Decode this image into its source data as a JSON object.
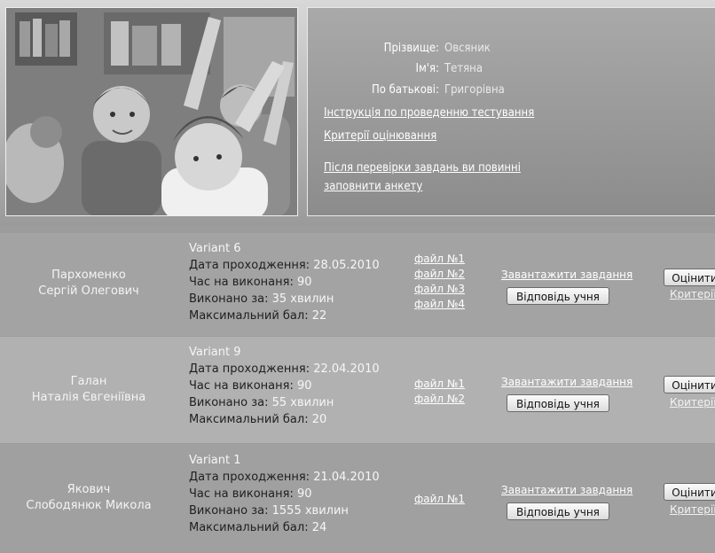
{
  "profile": {
    "surname_label": "Прізвище:",
    "surname": "Овсяник",
    "name_label": "Ім'я:",
    "name": "Тетяна",
    "patronymic_label": "По батькові:",
    "patronymic": "Григорівна",
    "instructions_link": "Інструкція по проведенню тестування",
    "criteria_link": "Критерії оцінювання",
    "survey_line1": "Після перевірки завдань ви повинні",
    "survey_line2": "заповнити анкету"
  },
  "labels": {
    "date": "Дата проходження:",
    "time": "Час на виконаня:",
    "done": "Виконано за:",
    "max": "Максимальний бал:",
    "download": "Завантажити завдання",
    "answer": "Відповідь учня",
    "grade": "Оцінити",
    "criteria": "Критерії"
  },
  "rows": [
    {
      "surname": "Пархоменко",
      "name": "Сергій Олегович",
      "variant": "Variant 6",
      "date": "28.05.2010",
      "time": "90",
      "done": "35 хвилин",
      "max": "22",
      "files": [
        "файл №1",
        "файл №2",
        "файл №3",
        "файл №4"
      ]
    },
    {
      "surname": "Галан",
      "name": "Наталія Євгеніївна",
      "variant": "Variant 9",
      "date": "22.04.2010",
      "time": "90",
      "done": "55 хвилин",
      "max": "20",
      "files": [
        "файл №1",
        "файл №2"
      ]
    },
    {
      "surname": "Якович",
      "name": "Слободянюк Микола",
      "variant": "Variant 1",
      "date": "21.04.2010",
      "time": "90",
      "done": "1555 хвилин",
      "max": "24",
      "files": [
        "файл №1"
      ]
    }
  ]
}
